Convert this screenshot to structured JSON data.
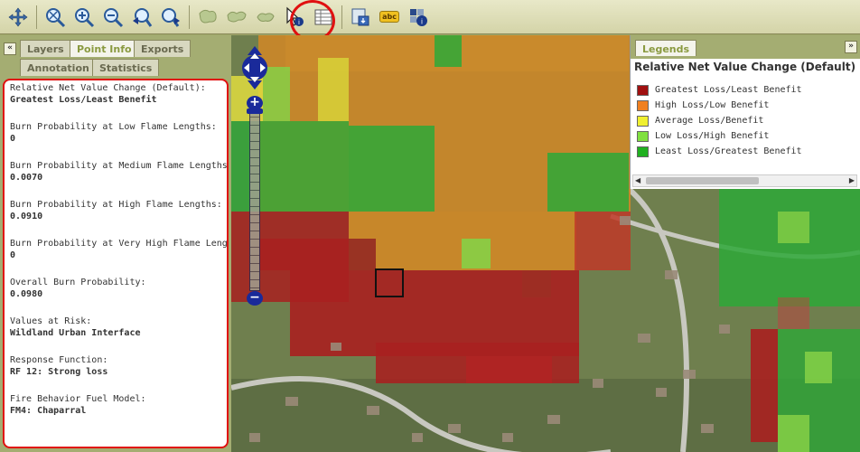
{
  "toolbar": {
    "tools": [
      "pan-icon",
      "zoom-extent-icon",
      "zoom-in-icon",
      "zoom-out-icon",
      "zoom-previous-icon",
      "zoom-next-icon",
      "select-area-icon",
      "select-polygon-icon",
      "select-freehand-icon",
      "point-info-icon",
      "table-icon",
      "export-map-icon",
      "label-icon",
      "map-info-icon"
    ],
    "label_tool_text": "abc"
  },
  "left_panel": {
    "collapse_symbol": "«",
    "tabs": [
      {
        "label": "Layers",
        "active": false
      },
      {
        "label": "Point Info",
        "active": true
      },
      {
        "label": "Exports",
        "active": false
      },
      {
        "label": "Annotation",
        "active": false
      },
      {
        "label": "Statistics",
        "active": false
      }
    ],
    "point_info": [
      {
        "label": "Relative Net Value Change (Default):",
        "value": "Greatest Loss/Least Benefit"
      },
      {
        "label": "Burn Probability at Low Flame Lengths:",
        "value": "0"
      },
      {
        "label": "Burn Probability at Medium Flame Lengths:",
        "value": "0.0070"
      },
      {
        "label": "Burn Probability at High Flame Lengths:",
        "value": "0.0910"
      },
      {
        "label": "Burn Probability at Very High Flame Lengths:",
        "value": "0"
      },
      {
        "label": "Overall Burn Probability:",
        "value": "0.0980"
      },
      {
        "label": "Values at Risk:",
        "value": "Wildland Urban Interface"
      },
      {
        "label": "Response Function:",
        "value": "RF 12: Strong loss"
      },
      {
        "label": "Fire Behavior Fuel Model:",
        "value": "FM4: Chaparral"
      }
    ]
  },
  "map": {
    "zoom_in_symbol": "+",
    "zoom_out_symbol": "−",
    "colors": {
      "greatest_loss": "#a01818",
      "high_loss": "#e08a1a",
      "average": "#e8e040",
      "low_loss": "#78d840",
      "least_loss": "#20a830"
    }
  },
  "legend": {
    "tab_label": "Legends",
    "collapse_symbol": "»",
    "title": "Relative Net Value Change (Default)",
    "items": [
      {
        "label": "Greatest Loss/Least Benefit",
        "color": "#a01010"
      },
      {
        "label": "High Loss/Low Benefit",
        "color": "#f08020"
      },
      {
        "label": "Average Loss/Benefit",
        "color": "#f0f030"
      },
      {
        "label": "Low Loss/High Benefit",
        "color": "#80e040"
      },
      {
        "label": "Least Loss/Greatest Benefit",
        "color": "#20b020"
      }
    ]
  }
}
